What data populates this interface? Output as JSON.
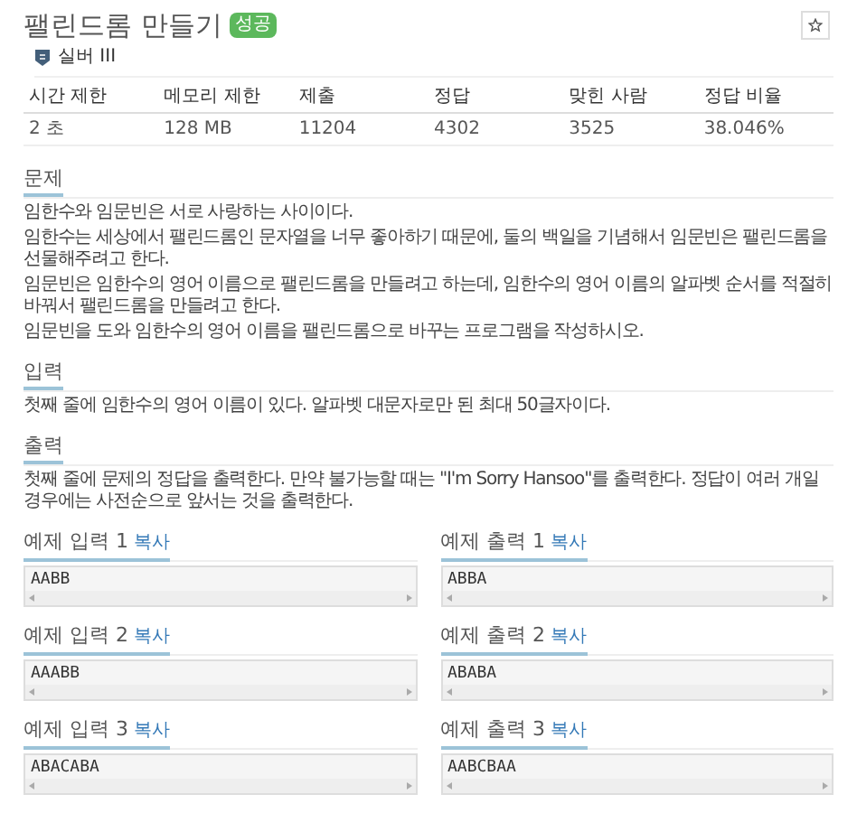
{
  "title": "팰린드롬 만들기",
  "badge": "성공",
  "tier": "실버 III",
  "stats": {
    "columns": [
      "시간 제한",
      "메모리 제한",
      "제출",
      "정답",
      "맞힌 사람",
      "정답 비율"
    ],
    "values": [
      "2 초",
      "128 MB",
      "11204",
      "4302",
      "3525",
      "38.046%"
    ]
  },
  "sections": [
    {
      "heading": "문제",
      "paragraphs": [
        "임한수와 임문빈은 서로 사랑하는 사이이다.",
        "임한수는 세상에서 팰린드롬인 문자열을 너무 좋아하기 때문에, 둘의 백일을 기념해서 임문빈은 팰린드롬을 선물해주려고 한다.",
        "임문빈은 임한수의 영어 이름으로 팰린드롬을 만들려고 하는데, 임한수의 영어 이름의 알파벳 순서를 적절히 바꿔서 팰린드롬을 만들려고 한다.",
        "임문빈을 도와 임한수의 영어 이름을 팰린드롬으로 바꾸는 프로그램을 작성하시오."
      ]
    },
    {
      "heading": "입력",
      "paragraphs": [
        "첫째 줄에 임한수의 영어 이름이 있다. 알파벳 대문자로만 된 최대 50글자이다."
      ]
    },
    {
      "heading": "출력",
      "paragraphs": [
        "첫째 줄에 문제의 정답을 출력한다. 만약 불가능할 때는 \"I'm Sorry Hansoo\"를 출력한다. 정답이 여러 개일 경우에는 사전순으로 앞서는 것을 출력한다."
      ]
    }
  ],
  "samples": [
    {
      "input_title": "예제 입력 1",
      "input_copy": "복사",
      "input": "AABB",
      "output_title": "예제 출력 1",
      "output_copy": "복사",
      "output": "ABBA"
    },
    {
      "input_title": "예제 입력 2",
      "input_copy": "복사",
      "input": "AAABB",
      "output_title": "예제 출력 2",
      "output_copy": "복사",
      "output": "ABABA"
    },
    {
      "input_title": "예제 입력 3",
      "input_copy": "복사",
      "input": "ABACABA",
      "output_title": "예제 출력 3",
      "output_copy": "복사",
      "output": "AABCBAA"
    }
  ]
}
